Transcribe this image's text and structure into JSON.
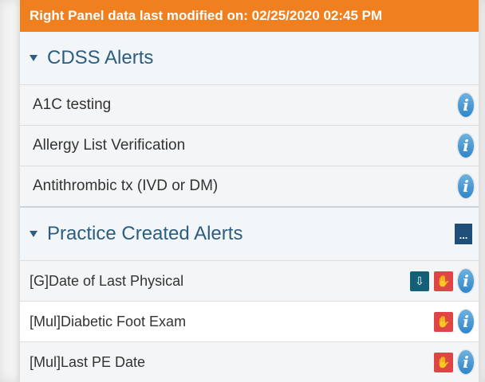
{
  "banner": {
    "text": "Right Panel data last modified on: 02/25/2020 02:45 PM"
  },
  "cdss": {
    "title": "CDSS Alerts",
    "items": [
      {
        "label": "A1C testing"
      },
      {
        "label": "Allergy List Verification"
      },
      {
        "label": "Antithrombic tx (IVD or DM)"
      }
    ]
  },
  "practice": {
    "title": "Practice Created Alerts",
    "more_label": "...",
    "items": [
      {
        "label": "[G]Date of Last Physical"
      },
      {
        "label": "[Mul]Diabetic Foot Exam"
      },
      {
        "label": "[Mul]Last PE Date"
      }
    ]
  },
  "icons": {
    "info_glyph": "i",
    "hand_glyph": "✋",
    "download_glyph": "⇩"
  },
  "colors": {
    "banner": "#f07f1f",
    "header_text": "#2d5d80",
    "info": "#2f86c9",
    "red_action": "#e04545",
    "teal_action": "#145f77",
    "more_button": "#1f4e79"
  }
}
